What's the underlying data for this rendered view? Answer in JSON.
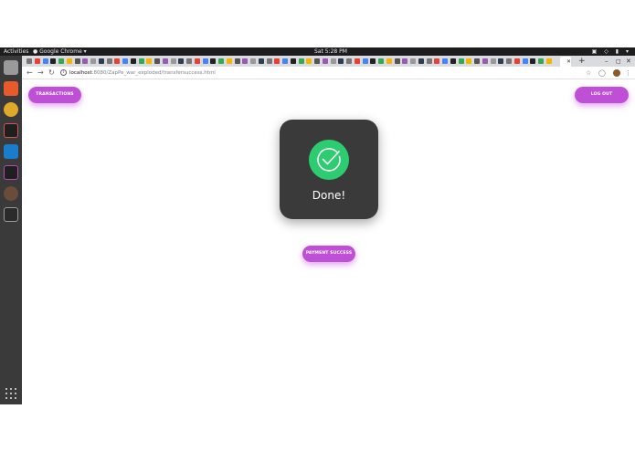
{
  "topbar": {
    "activities": "Activities",
    "app_menu": "Google Chrome",
    "clock": "Sat  5:28 PM"
  },
  "browser": {
    "url_host": "localhost",
    "url_path": ":8080/ZapPe_war_exploded/transfersuccess.html"
  },
  "page": {
    "transactions_label": "TRANSACTIONS",
    "logout_label": "LOG OUT",
    "done_text": "Done!",
    "payment_success_label": "PAYMENT SUCCESS"
  },
  "colors": {
    "accent": "#c04fd7",
    "card": "#3a3a3a",
    "success": "#2ecc71"
  }
}
